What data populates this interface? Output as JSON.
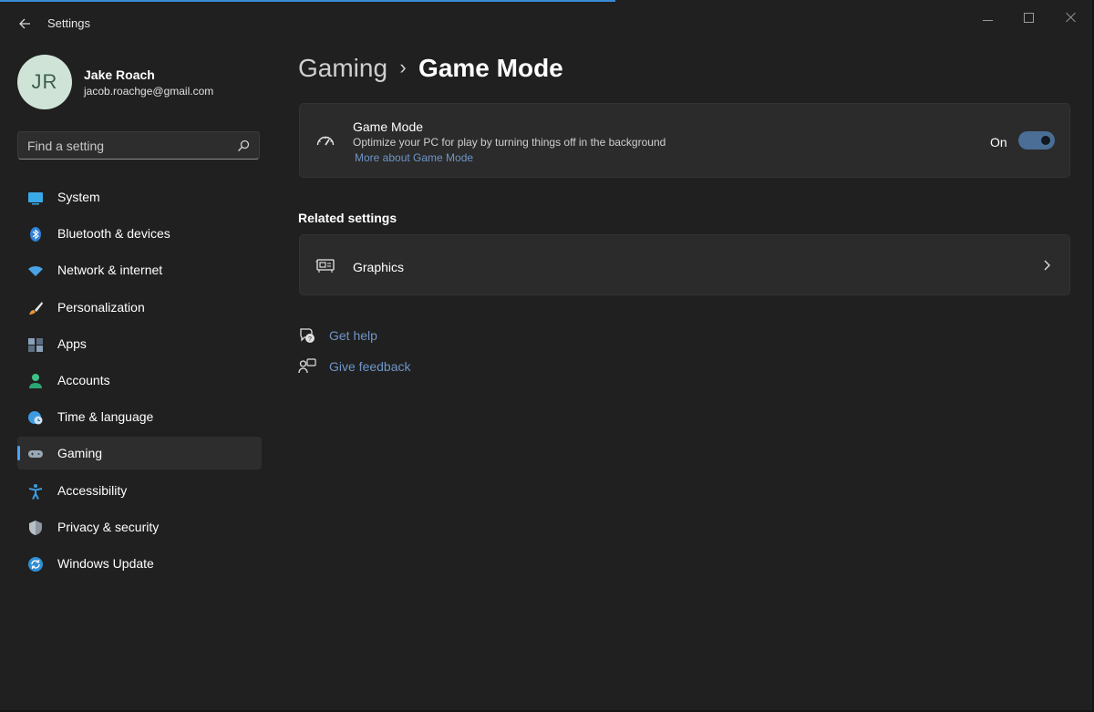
{
  "window": {
    "title": "Settings",
    "accent": "#4aa3ff"
  },
  "profile": {
    "initials": "JR",
    "name": "Jake Roach",
    "email": "jacob.roachge@gmail.com"
  },
  "search": {
    "placeholder": "Find a setting"
  },
  "sidebar": {
    "items": [
      {
        "label": "System",
        "icon": "monitor-icon"
      },
      {
        "label": "Bluetooth & devices",
        "icon": "bluetooth-icon"
      },
      {
        "label": "Network & internet",
        "icon": "wifi-icon"
      },
      {
        "label": "Personalization",
        "icon": "brush-icon"
      },
      {
        "label": "Apps",
        "icon": "apps-icon"
      },
      {
        "label": "Accounts",
        "icon": "person-icon"
      },
      {
        "label": "Time & language",
        "icon": "globe-clock-icon"
      },
      {
        "label": "Gaming",
        "icon": "gamepad-icon",
        "selected": true
      },
      {
        "label": "Accessibility",
        "icon": "accessibility-icon"
      },
      {
        "label": "Privacy & security",
        "icon": "shield-icon"
      },
      {
        "label": "Windows Update",
        "icon": "update-icon"
      }
    ]
  },
  "breadcrumb": {
    "parent": "Gaming",
    "separator": "›",
    "current": "Game Mode"
  },
  "game_mode": {
    "title": "Game Mode",
    "description": "Optimize your PC for play by turning things off in the background",
    "link": "More about Game Mode",
    "toggle_label": "On",
    "toggle_on": true
  },
  "related": {
    "heading": "Related settings",
    "graphics_label": "Graphics"
  },
  "help": {
    "get_help": "Get help",
    "give_feedback": "Give feedback"
  }
}
